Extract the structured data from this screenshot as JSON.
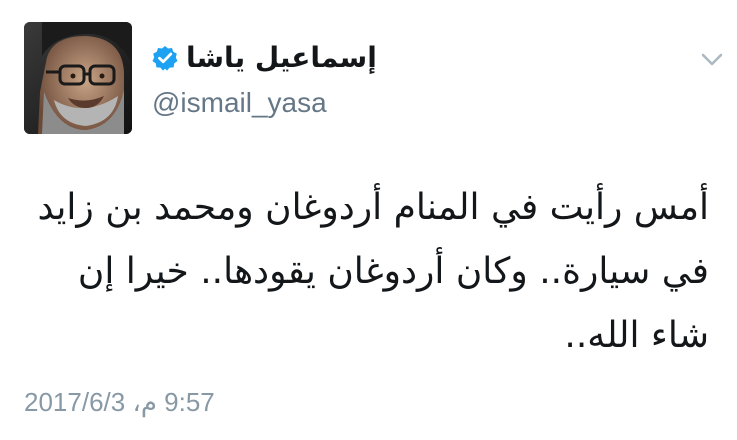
{
  "tweet": {
    "display_name": "إسماعيل ياشا",
    "handle": "@ismail_yasa",
    "text": "أمس رأيت في المنام أردوغان ومحمد بن زايد في سيارة.. وكان أردوغان يقودها.. خيرا إن شاء الله..",
    "timestamp": "9:57 م، 2017/6/3",
    "verified": true
  },
  "icons": {
    "verified": "verified-badge-icon",
    "menu": "chevron-down-icon",
    "avatar": "profile-photo"
  },
  "colors": {
    "verified_blue": "#1da1f2",
    "handle_gray": "#657786",
    "timestamp_gray": "#8899a6",
    "text": "#14171a"
  }
}
